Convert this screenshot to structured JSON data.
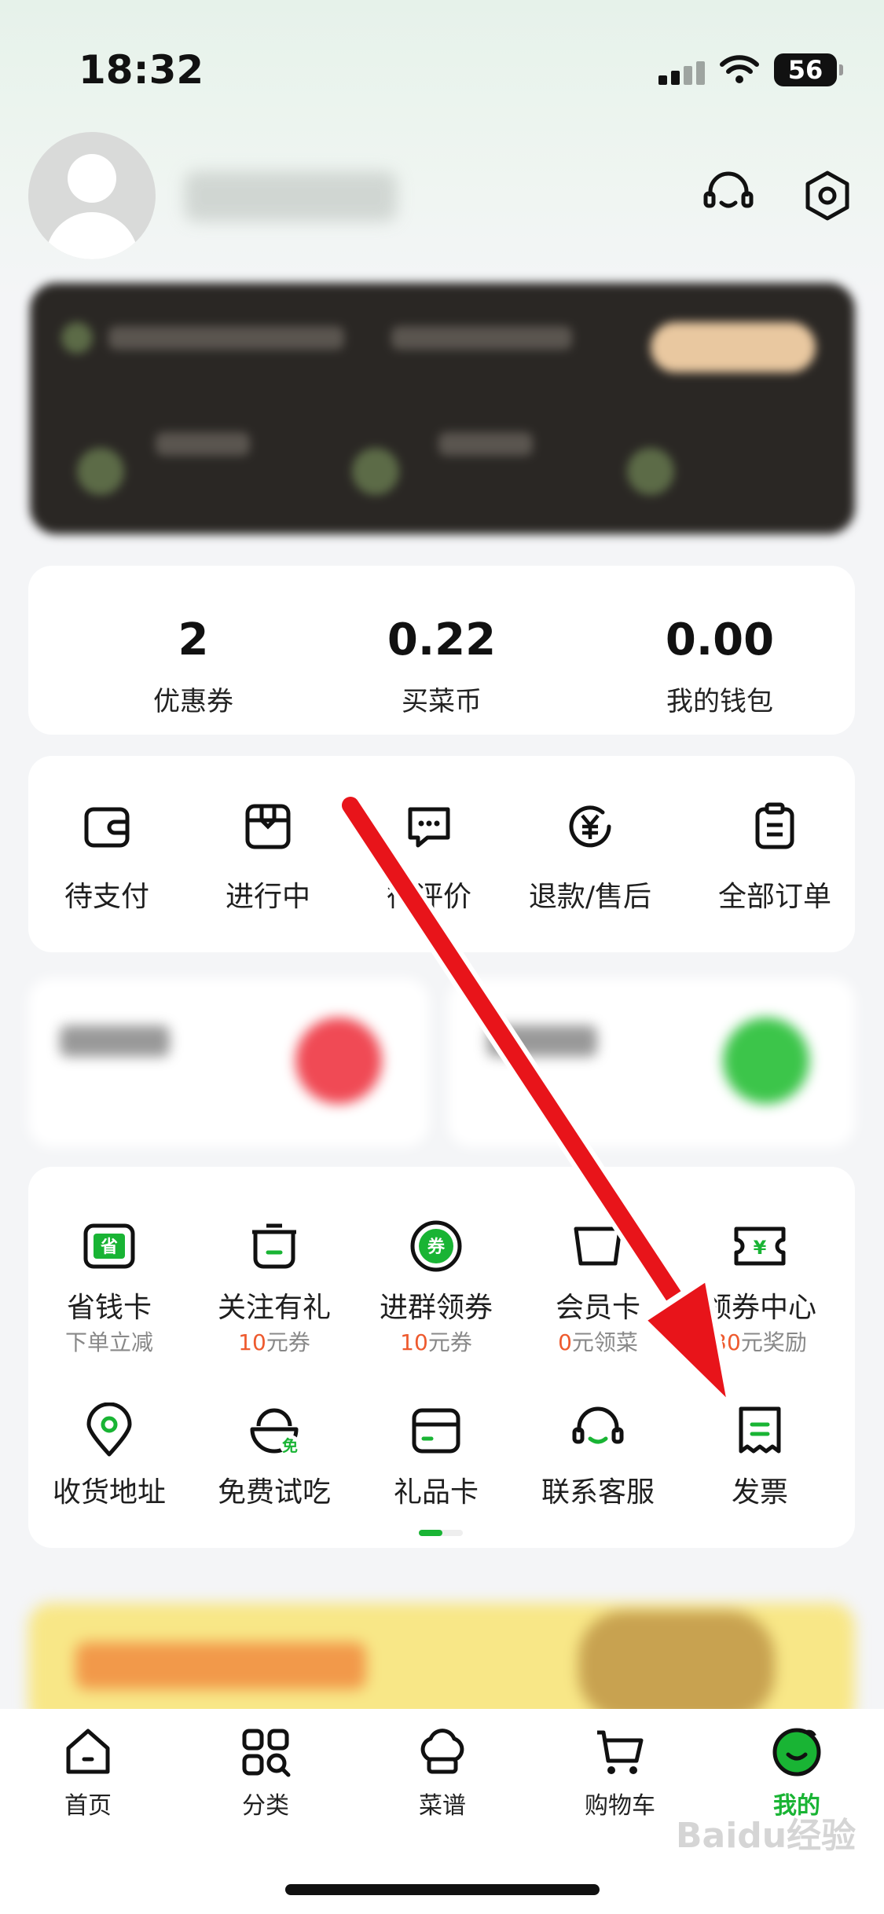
{
  "status_bar": {
    "time": "18:32",
    "battery": "56"
  },
  "profile": {
    "icons": [
      "headset-icon",
      "settings-icon"
    ]
  },
  "assets": [
    {
      "value": "2",
      "label": "优惠券"
    },
    {
      "value": "0.22",
      "label": "买菜币"
    },
    {
      "value": "0.00",
      "label": "我的钱包"
    }
  ],
  "orders": [
    {
      "label": "待支付",
      "icon": "wallet-icon"
    },
    {
      "label": "进行中",
      "icon": "box-icon"
    },
    {
      "label": "待评价",
      "icon": "chat-icon"
    },
    {
      "label": "退款/售后",
      "icon": "refund-icon"
    },
    {
      "label": "全部订单",
      "icon": "clipboard-icon"
    }
  ],
  "services": [
    {
      "label": "省钱卡",
      "sub": "下单立减",
      "sub_num": "",
      "icon": "save-card-icon"
    },
    {
      "label": "关注有礼",
      "sub": "元券",
      "sub_num": "10",
      "icon": "gift-pot-icon"
    },
    {
      "label": "进群领券",
      "sub": "元券",
      "sub_num": "10",
      "icon": "coupon-circle-icon"
    },
    {
      "label": "会员卡",
      "sub": "元领菜",
      "sub_num": "0",
      "icon": "member-card-icon"
    },
    {
      "label": "领券中心",
      "sub": "元奖励",
      "sub_num": "30",
      "icon": "ticket-icon"
    },
    {
      "label": "收货地址",
      "icon": "location-icon"
    },
    {
      "label": "免费试吃",
      "icon": "free-bowl-icon",
      "badge": "免"
    },
    {
      "label": "礼品卡",
      "icon": "gift-card-icon"
    },
    {
      "label": "联系客服",
      "icon": "headset-icon"
    },
    {
      "label": "发票",
      "icon": "invoice-icon"
    }
  ],
  "tabs": [
    {
      "label": "首页",
      "active": false
    },
    {
      "label": "分类",
      "active": false
    },
    {
      "label": "菜谱",
      "active": false
    },
    {
      "label": "购物车",
      "active": false
    },
    {
      "label": "我的",
      "active": true
    }
  ],
  "watermark": "Baidu经验",
  "colors": {
    "accent": "#19b434",
    "promo_red": "#ee5a2e",
    "arrow": "#e8141a"
  }
}
